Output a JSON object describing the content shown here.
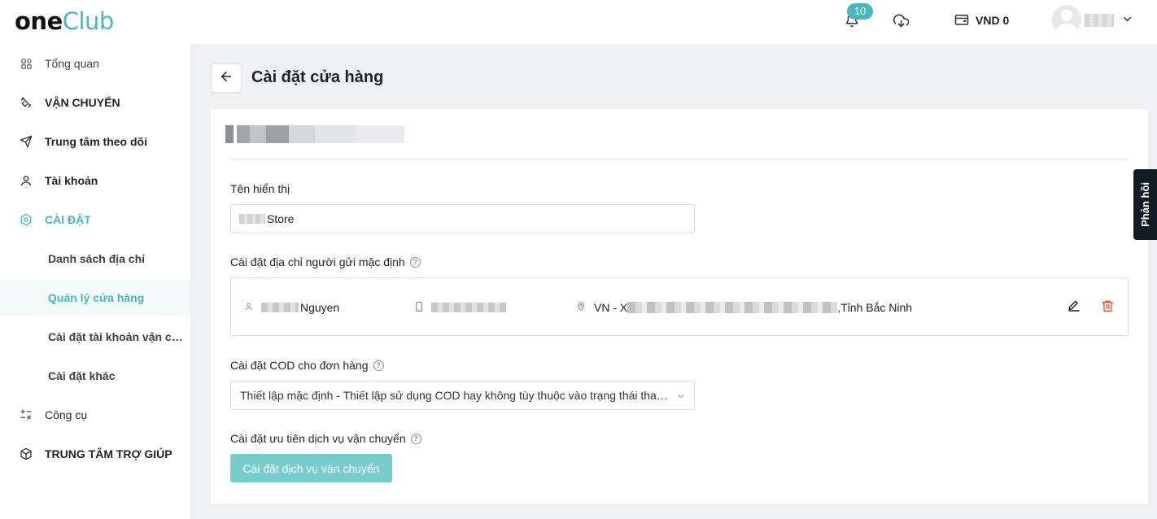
{
  "header": {
    "logo_one": "one",
    "logo_club": "Club",
    "notification_count": "10",
    "balance": "VND 0"
  },
  "sidebar": {
    "items": [
      {
        "label": "Tổng quan",
        "icon": "dashboard-icon"
      },
      {
        "label": "VẬN CHUYỂN",
        "icon": "shipping-icon"
      },
      {
        "label": "Trung tâm theo dõi",
        "icon": "send-icon"
      },
      {
        "label": "Tài khoản",
        "icon": "user-icon"
      },
      {
        "label": "CÀI ĐẶT",
        "icon": "settings-icon"
      },
      {
        "label": "Danh sách địa chỉ"
      },
      {
        "label": "Quản lý cửa hàng"
      },
      {
        "label": "Cài đặt tài khoản vận chuyển"
      },
      {
        "label": "Cài đặt khác"
      },
      {
        "label": "Công cụ",
        "icon": "tools-icon"
      },
      {
        "label": "TRUNG TÂM TRỢ GIÚP",
        "icon": "box-icon"
      }
    ],
    "accent_color": "#4ab6c0"
  },
  "page": {
    "title": "Cài đặt cửa hàng"
  },
  "form": {
    "display_name_label": "Tên hiển thị",
    "display_name_value": "Store",
    "sender_address_label": "Cài đặt địa chỉ người gửi mặc định",
    "address": {
      "name": "Nguyen",
      "location_prefix": "VN - X",
      "location_suffix": ",Tỉnh Bắc Ninh"
    },
    "cod_label": "Cài đặt COD cho đơn hàng",
    "cod_value": "Thiết lập mặc định - Thiết lập sử dụng COD hay không tùy thuộc vào trạng thái thanh toán của đơn hàng",
    "shipping_priority_label": "Cài đặt ưu tiên dịch vụ vận chuyển",
    "shipping_priority_button": "Cài đặt dịch vụ vận chuyển"
  },
  "feedback": {
    "label": "Phản hồi"
  }
}
